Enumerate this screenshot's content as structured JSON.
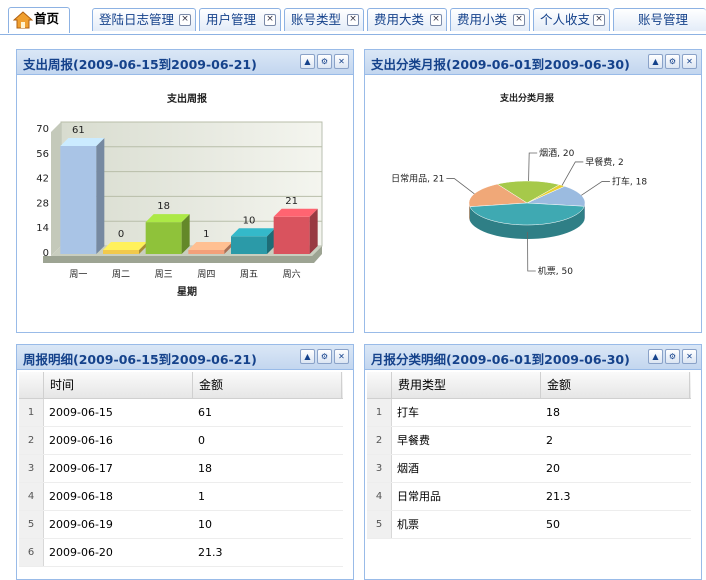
{
  "tabs": [
    {
      "label": "首页",
      "active": true,
      "closable": false
    },
    {
      "label": "登陆日志管理",
      "closable": true
    },
    {
      "label": "用户管理",
      "closable": true
    },
    {
      "label": "账号类型",
      "closable": true
    },
    {
      "label": "费用大类",
      "closable": true
    },
    {
      "label": "费用小类",
      "closable": true
    },
    {
      "label": "个人收支",
      "closable": true
    },
    {
      "label": "账号管理",
      "closable": true
    }
  ],
  "panels": {
    "weekly_chart": {
      "title": "支出周报(2009-06-15到2009-06-21)"
    },
    "monthly_chart": {
      "title": "支出分类月报(2009-06-01到2009-06-30)"
    },
    "weekly_detail": {
      "title": "周报明细(2009-06-15到2009-06-21)"
    },
    "monthly_detail": {
      "title": "月报分类明细(2009-06-01到2009-06-30)"
    }
  },
  "chart_data": [
    {
      "type": "bar",
      "title": "支出周报",
      "xlabel": "星期",
      "ylabel": "",
      "categories": [
        "周一",
        "周二",
        "周三",
        "周四",
        "周五",
        "周六"
      ],
      "values": [
        61,
        0,
        18,
        1,
        10,
        21
      ],
      "data_labels": [
        "61",
        "0",
        "18",
        "1",
        "10",
        "21"
      ],
      "yticks": [
        "0",
        "14",
        "28",
        "42",
        "56",
        "70"
      ],
      "ylim": [
        0,
        70
      ],
      "colors": [
        "#a9c4e6",
        "#f2c94c",
        "#8fc23a",
        "#f3a07a",
        "#2b9aa8",
        "#d9535e"
      ]
    },
    {
      "type": "pie",
      "title": "支出分类月报",
      "slices": [
        {
          "label": "打车",
          "value": 18,
          "text": "打车, 18",
          "color": "#9bbbe0"
        },
        {
          "label": "早餐费",
          "value": 2,
          "text": "早餐费, 2",
          "color": "#e8d030"
        },
        {
          "label": "烟酒",
          "value": 20,
          "text": "烟酒, 20",
          "color": "#a6c94a"
        },
        {
          "label": "日常用品",
          "value": 21.3,
          "text": "日常用品, 21",
          "color": "#f0a878"
        },
        {
          "label": "机票",
          "value": 50,
          "text": "机票, 50",
          "color": "#3fa9b2"
        }
      ]
    }
  ],
  "weekly_table": {
    "columns": [
      "时间",
      "金额"
    ],
    "rows": [
      {
        "n": "1",
        "c1": "2009-06-15",
        "c2": "61"
      },
      {
        "n": "2",
        "c1": "2009-06-16",
        "c2": "0"
      },
      {
        "n": "3",
        "c1": "2009-06-17",
        "c2": "18"
      },
      {
        "n": "4",
        "c1": "2009-06-18",
        "c2": "1"
      },
      {
        "n": "5",
        "c1": "2009-06-19",
        "c2": "10"
      },
      {
        "n": "6",
        "c1": "2009-06-20",
        "c2": "21.3"
      }
    ]
  },
  "monthly_table": {
    "columns": [
      "费用类型",
      "金额"
    ],
    "rows": [
      {
        "n": "1",
        "c1": "打车",
        "c2": "18"
      },
      {
        "n": "2",
        "c1": "早餐费",
        "c2": "2"
      },
      {
        "n": "3",
        "c1": "烟酒",
        "c2": "20"
      },
      {
        "n": "4",
        "c1": "日常用品",
        "c2": "21.3"
      },
      {
        "n": "5",
        "c1": "机票",
        "c2": "50"
      }
    ]
  }
}
